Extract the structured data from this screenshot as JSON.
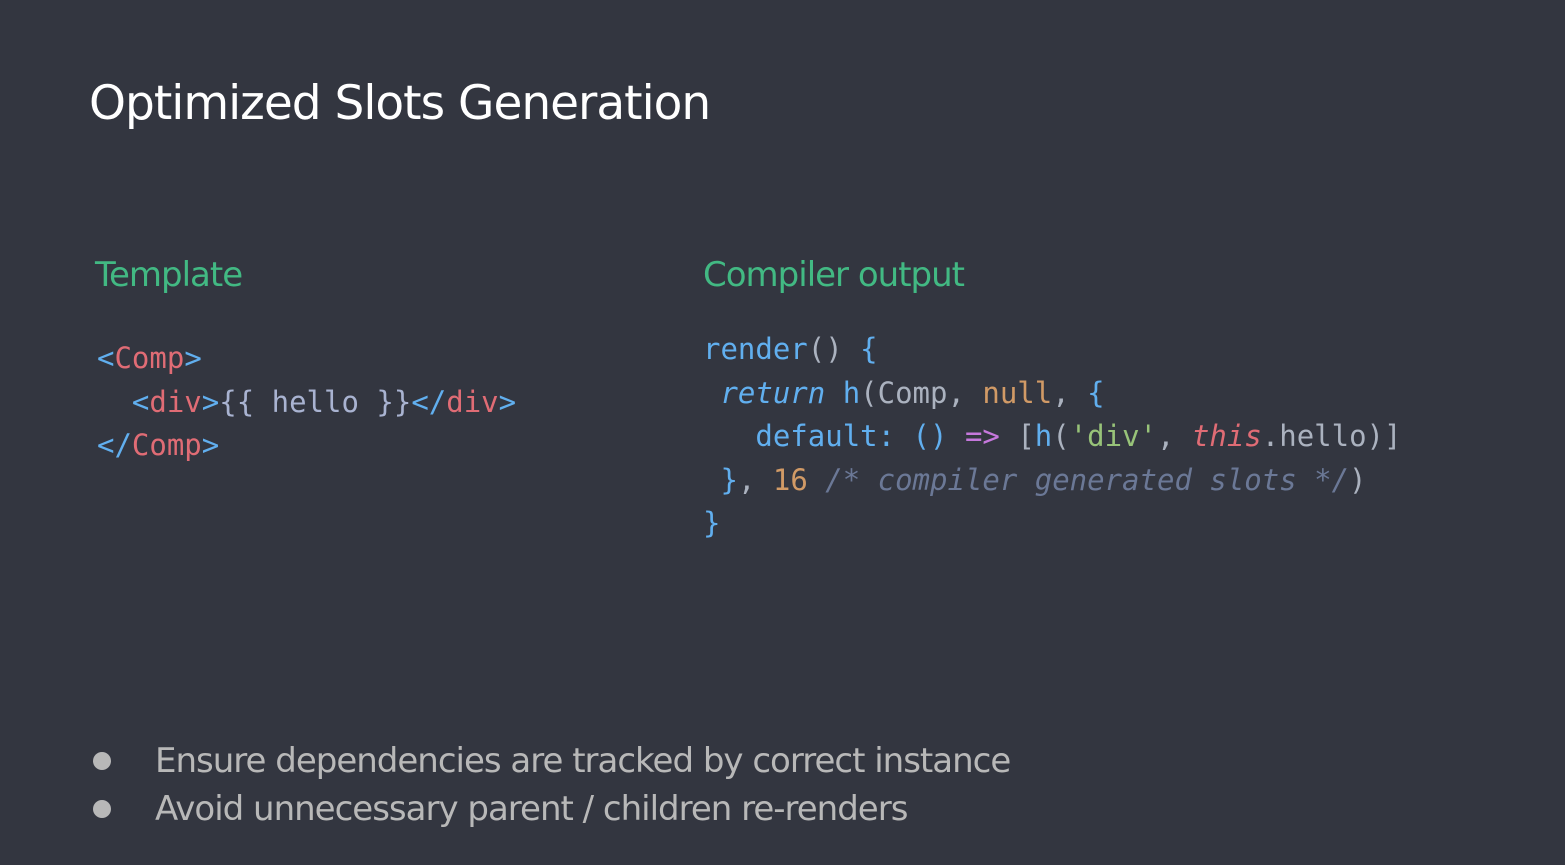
{
  "slide": {
    "title": "Optimized Slots Generation",
    "left_heading": "Template",
    "right_heading": "Compiler output",
    "template_code": [
      [
        {
          "t": "<",
          "c": "punct"
        },
        {
          "t": "Comp",
          "c": "tag"
        },
        {
          "t": ">",
          "c": "punct"
        }
      ],
      [
        {
          "t": "  ",
          "c": "plain"
        },
        {
          "t": "<",
          "c": "punct"
        },
        {
          "t": "div",
          "c": "tag"
        },
        {
          "t": ">",
          "c": "punct"
        },
        {
          "t": "{{ hello }}",
          "c": "text"
        },
        {
          "t": "</",
          "c": "punct"
        },
        {
          "t": "div",
          "c": "tag"
        },
        {
          "t": ">",
          "c": "punct"
        }
      ],
      [
        {
          "t": "</",
          "c": "punct"
        },
        {
          "t": "Comp",
          "c": "tag"
        },
        {
          "t": ">",
          "c": "punct"
        }
      ]
    ],
    "output_code": [
      [
        {
          "t": "render",
          "c": "fn"
        },
        {
          "t": "() ",
          "c": "plain"
        },
        {
          "t": "{",
          "c": "brace"
        }
      ],
      [
        {
          "t": " ",
          "c": "plain"
        },
        {
          "t": "return",
          "c": "fn it"
        },
        {
          "t": " ",
          "c": "plain"
        },
        {
          "t": "h",
          "c": "fn"
        },
        {
          "t": "(Comp, ",
          "c": "plain"
        },
        {
          "t": "null",
          "c": "null"
        },
        {
          "t": ", ",
          "c": "plain"
        },
        {
          "t": "{",
          "c": "brace"
        }
      ],
      [
        {
          "t": "   ",
          "c": "plain"
        },
        {
          "t": "default:",
          "c": "prop"
        },
        {
          "t": " ",
          "c": "plain"
        },
        {
          "t": "()",
          "c": "brace"
        },
        {
          "t": " ",
          "c": "plain"
        },
        {
          "t": "=>",
          "c": "kw"
        },
        {
          "t": " [",
          "c": "plain"
        },
        {
          "t": "h",
          "c": "fn"
        },
        {
          "t": "(",
          "c": "plain"
        },
        {
          "t": "'div'",
          "c": "str"
        },
        {
          "t": ", ",
          "c": "plain"
        },
        {
          "t": "this",
          "c": "this"
        },
        {
          "t": ".hello)]",
          "c": "plain"
        }
      ],
      [
        {
          "t": " ",
          "c": "plain"
        },
        {
          "t": "}",
          "c": "brace"
        },
        {
          "t": ", ",
          "c": "plain"
        },
        {
          "t": "16",
          "c": "num"
        },
        {
          "t": " ",
          "c": "plain"
        },
        {
          "t": "/* compiler generated slots */",
          "c": "cmt"
        },
        {
          "t": ")",
          "c": "plain"
        }
      ],
      [
        {
          "t": "}",
          "c": "brace"
        }
      ]
    ],
    "bullets": [
      "Ensure dependencies are tracked by correct instance",
      "Avoid unnecessary parent / children re-renders"
    ]
  }
}
